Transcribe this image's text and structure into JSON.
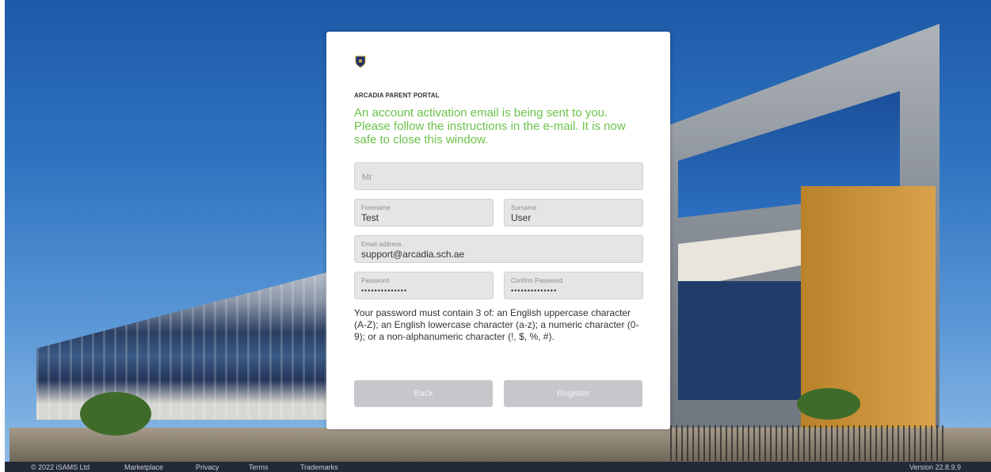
{
  "portal": {
    "title": "ARCADIA PARENT PORTAL",
    "message": "An account activation email is being sent to you. Please follow the instructions in the e-mail. It is now safe to close this window."
  },
  "form": {
    "title_field": {
      "placeholder": "Mr"
    },
    "forename": {
      "label": "Forename",
      "value": "Test"
    },
    "surname": {
      "label": "Surname",
      "value": "User"
    },
    "email": {
      "label": "Email address",
      "value": "support@arcadia.sch.ae"
    },
    "password": {
      "label": "Password",
      "value": "••••••••••••••"
    },
    "confirm_password": {
      "label": "Confirm Password",
      "value": "••••••••••••••"
    },
    "password_help": "Your password must contain 3 of: an English uppercase character (A-Z); an English lowercase character (a-z); a numeric character (0-9); or a non-alphanumeric character (!, $, %, #).",
    "back_label": "Back",
    "register_label": "Register"
  },
  "footer": {
    "copyright": "© 2022 iSAMS Ltd",
    "links": [
      "Marketplace",
      "Privacy",
      "Terms",
      "Trademarks"
    ],
    "version": "Version 22.8.9.9"
  },
  "colors": {
    "message_green": "#6cc24a",
    "field_bg": "#e6e5e6",
    "button_bg": "#c9c6cb",
    "footer_bg": "#232a36"
  },
  "icons": {
    "logo": "school-crest-icon"
  }
}
